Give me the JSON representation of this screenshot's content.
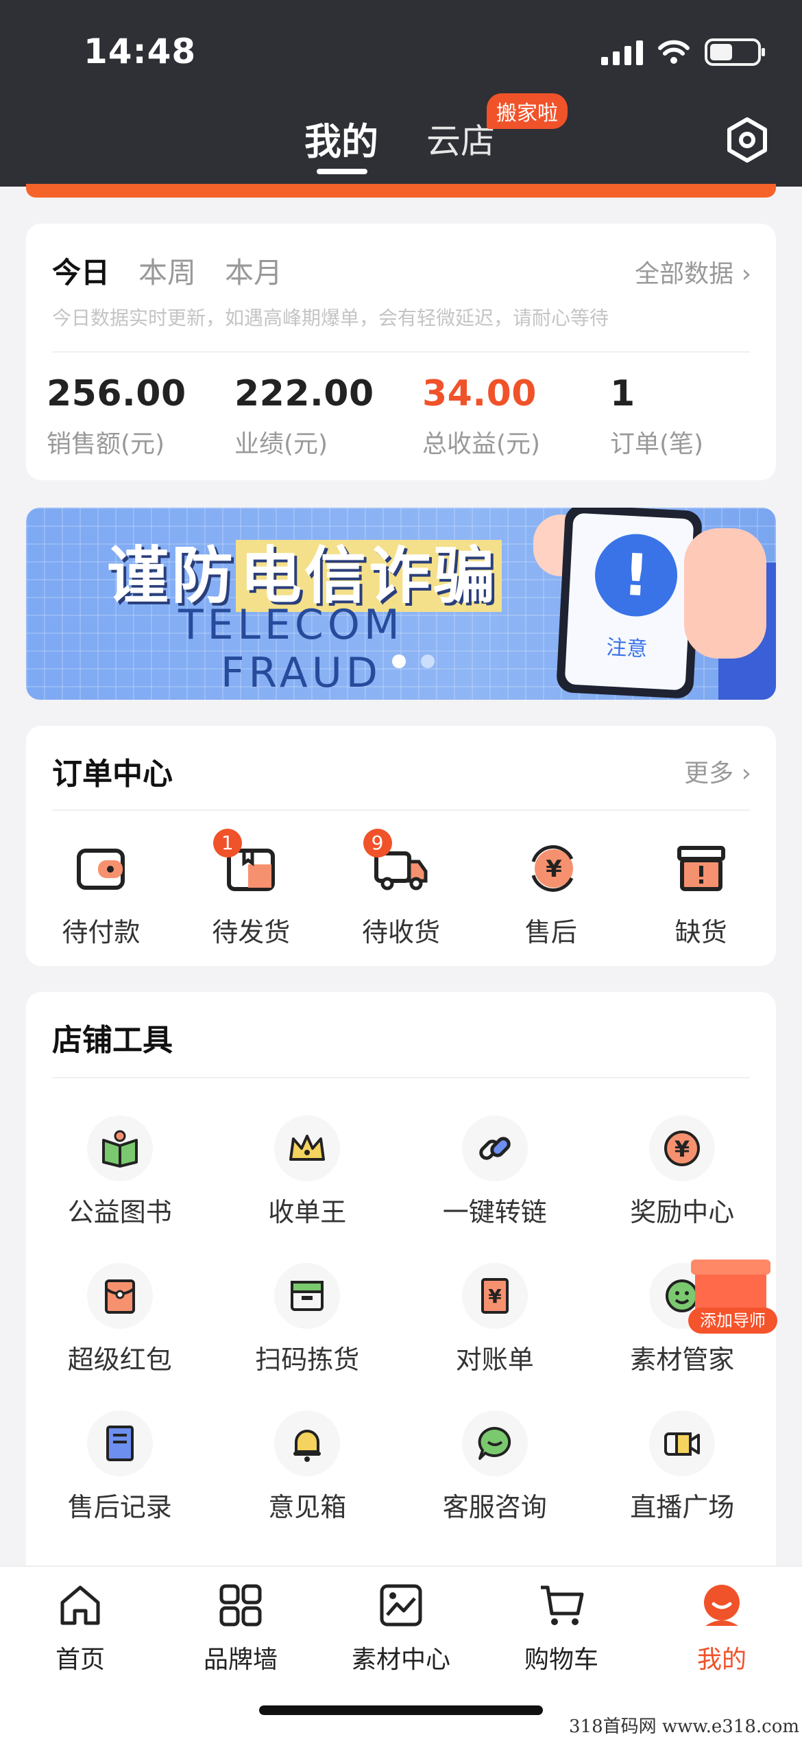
{
  "status_bar": {
    "time": "14:48"
  },
  "header": {
    "tab_active": "我的",
    "tab_other": "云店",
    "tab_other_badge": "搬家啦",
    "settings_icon": "hexagon-settings-icon"
  },
  "stats": {
    "tabs": [
      "今日",
      "本周",
      "本月"
    ],
    "all_data": "全部数据 ›",
    "note": "今日数据实时更新，如遇高峰期爆单，会有轻微延迟，请耐心等待",
    "items": [
      {
        "value": "256.00",
        "label": "销售额(元)"
      },
      {
        "value": "222.00",
        "label": "业绩(元)"
      },
      {
        "value": "34.00",
        "label": "总收益(元)"
      },
      {
        "value": "1",
        "label": "订单(笔)"
      }
    ]
  },
  "banner": {
    "title_a": "谨防",
    "title_b": "电信诈骗",
    "en_line1": "TELECOM",
    "en_line2": "FRAUD",
    "alert_mark": "!",
    "alert_text": "注意"
  },
  "orders": {
    "title": "订单中心",
    "more": "更多 ›",
    "items": [
      {
        "label": "待付款",
        "badge": ""
      },
      {
        "label": "待发货",
        "badge": "1"
      },
      {
        "label": "待收货",
        "badge": "9"
      },
      {
        "label": "售后",
        "badge": ""
      },
      {
        "label": "缺货",
        "badge": ""
      }
    ]
  },
  "tools": {
    "title": "店铺工具",
    "items": [
      {
        "label": "公益图书",
        "icon": "book-icon"
      },
      {
        "label": "收单王",
        "icon": "crown-icon"
      },
      {
        "label": "一键转链",
        "icon": "link-icon"
      },
      {
        "label": "奖励中心",
        "icon": "yuan-coin-icon"
      },
      {
        "label": "超级红包",
        "icon": "red-packet-icon"
      },
      {
        "label": "扫码拣货",
        "icon": "scan-box-icon"
      },
      {
        "label": "对账单",
        "icon": "bill-icon"
      },
      {
        "label": "素材管家",
        "icon": "smile-icon"
      },
      {
        "label": "售后记录",
        "icon": "record-icon"
      },
      {
        "label": "意见箱",
        "icon": "bell-icon"
      },
      {
        "label": "客服咨询",
        "icon": "chat-icon"
      },
      {
        "label": "直播广场",
        "icon": "video-icon"
      }
    ],
    "float_label": "添加导师"
  },
  "nav": {
    "items": [
      {
        "label": "首页",
        "icon": "home-icon"
      },
      {
        "label": "品牌墙",
        "icon": "grid-icon"
      },
      {
        "label": "素材中心",
        "icon": "image-icon"
      },
      {
        "label": "购物车",
        "icon": "cart-icon"
      },
      {
        "label": "我的",
        "icon": "profile-icon"
      }
    ]
  },
  "watermark": "318首码网 www.e318.com",
  "colors": {
    "accent": "#f0522a",
    "header_bg": "#2e3035",
    "banner_bg": "#8fb6f5"
  }
}
